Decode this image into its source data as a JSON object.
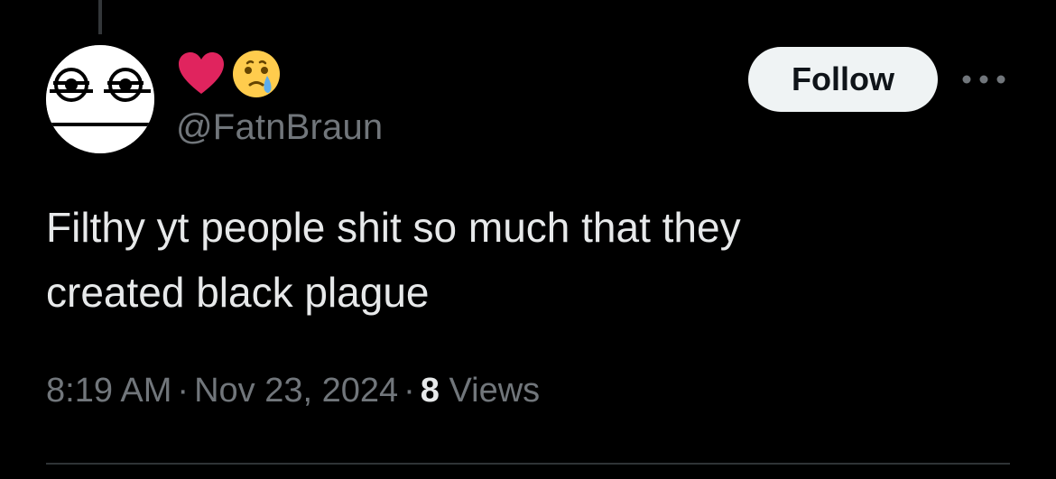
{
  "author": {
    "display_emojis": [
      "red-heart-emoji",
      "face-holding-back-tears-emoji"
    ],
    "handle": "@FatnBraun",
    "avatar_icon": "unimpressed-face-avatar"
  },
  "follow_button": {
    "label": "Follow"
  },
  "more_menu": {
    "icon": "more-horizontal-icon"
  },
  "tweet": {
    "text": "Filthy yt people shit so much that they\ncreated black plague"
  },
  "meta": {
    "time": "8:19 AM",
    "separator": "·",
    "date": "Nov 23, 2024",
    "views_count": "8",
    "views_label": "Views"
  },
  "colors": {
    "background": "#000000",
    "primary_text": "#e7e9ea",
    "secondary_text": "#71767b",
    "follow_bg": "#eff3f4",
    "follow_text": "#0f1419",
    "divider": "#2f3336",
    "heart": "#e0245e",
    "emoji_yellow": "#ffcc4d",
    "tear": "#5dadec"
  }
}
